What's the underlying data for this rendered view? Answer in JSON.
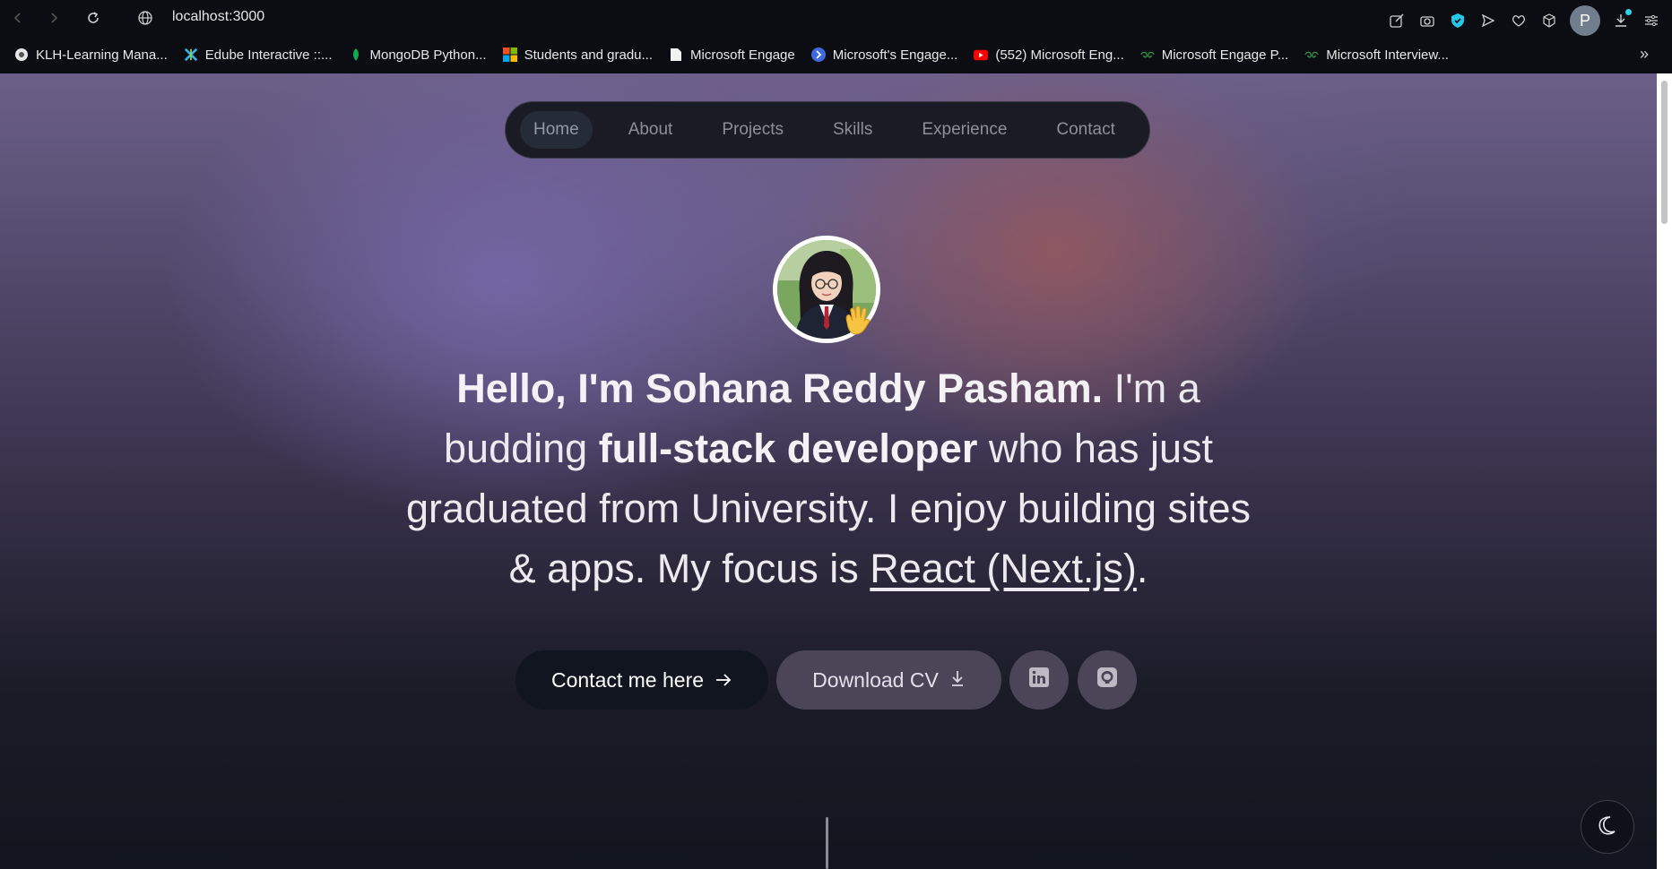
{
  "browser": {
    "url": "localhost:3000",
    "profile_initial": "P",
    "bookmarks": [
      {
        "label": "KLH-Learning Mana...",
        "icon": "klh-logo-icon"
      },
      {
        "label": "Edube Interactive ::...",
        "icon": "edube-logo-icon"
      },
      {
        "label": "MongoDB Python...",
        "icon": "mongodb-leaf-icon"
      },
      {
        "label": "Students and gradu...",
        "icon": "microsoft-logo-icon"
      },
      {
        "label": "Microsoft Engage",
        "icon": "document-icon"
      },
      {
        "label": "Microsoft's Engage...",
        "icon": "engage-logo-icon"
      },
      {
        "label": "(552) Microsoft Eng...",
        "icon": "youtube-icon"
      },
      {
        "label": "Microsoft Engage P...",
        "icon": "geeks-logo-icon"
      },
      {
        "label": "Microsoft Interview...",
        "icon": "geeks-logo-icon"
      }
    ],
    "more_bookmarks": "»"
  },
  "nav": {
    "items": [
      "Home",
      "About",
      "Projects",
      "Skills",
      "Experience",
      "Contact"
    ],
    "active": "Home"
  },
  "hero": {
    "greeting": "Hello, I'm Sohana Reddy Pasham.",
    "part1": " I'm a budding ",
    "role": "full-stack developer",
    "part2": " who has just graduated from University. I enjoy building sites & apps. My focus is ",
    "focus": "React (Next.js)",
    "end": "."
  },
  "buttons": {
    "contact": "Contact me here",
    "cv": "Download CV",
    "linkedin_icon": "linkedin-icon",
    "github_icon": "github-icon"
  },
  "colors": {
    "accent_dark": "#111520",
    "button_muted": "#4a4658"
  }
}
